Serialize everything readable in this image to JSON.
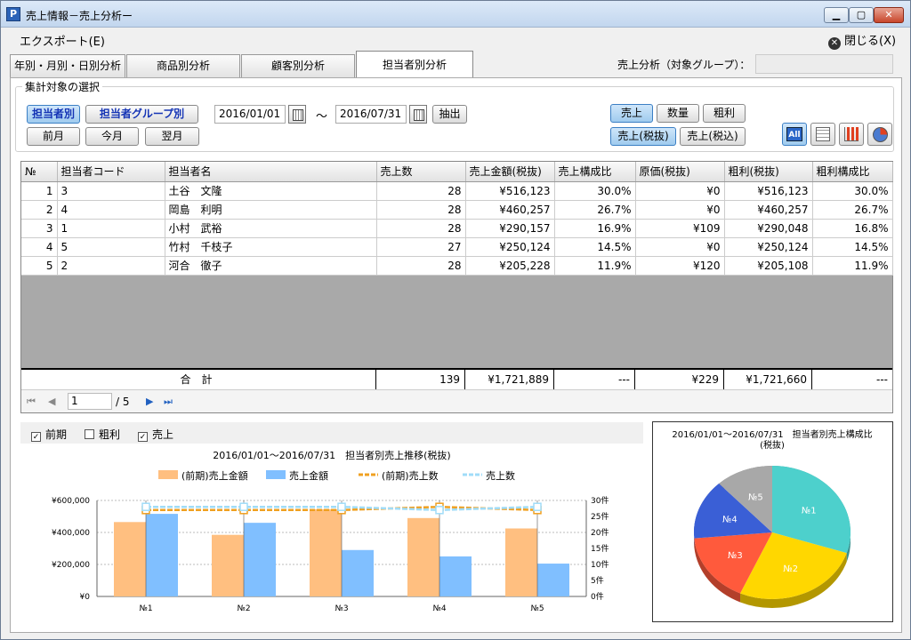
{
  "window": {
    "title": "売上情報－売上分析ー"
  },
  "menu": {
    "export": "エクスポート(E)",
    "close": "閉じる(X)"
  },
  "tabs": [
    {
      "label": "年別・月別・日別分析"
    },
    {
      "label": "商品別分析"
    },
    {
      "label": "顧客別分析"
    },
    {
      "label": "担当者別分析",
      "active": true
    }
  ],
  "group": {
    "label": "売上分析（対象グループ）：",
    "value": ""
  },
  "selection": {
    "legend": "集計対象の選択",
    "by_person": "担当者別",
    "by_group": "担当者グループ別",
    "date_from": "2016/01/01",
    "date_to": "2016/07/31",
    "tilde": "～",
    "extract": "抽出",
    "prev_month": "前月",
    "this_month": "今月",
    "next_month": "翌月",
    "metric_sales": "売上",
    "metric_qty": "数量",
    "metric_profit": "粗利",
    "tax_excl": "売上(税抜)",
    "tax_incl": "売上(税込)",
    "all_icon_text": "All"
  },
  "table": {
    "headers": [
      "№",
      "担当者コード",
      "担当者名",
      "売上数",
      "売上金額(税抜)",
      "売上構成比",
      "原価(税抜)",
      "粗利(税抜)",
      "粗利構成比"
    ],
    "rows": [
      [
        "1",
        "3",
        "土谷　文隆",
        "28",
        "¥516,123",
        "30.0%",
        "¥0",
        "¥516,123",
        "30.0%"
      ],
      [
        "2",
        "4",
        "岡島　利明",
        "28",
        "¥460,257",
        "26.7%",
        "¥0",
        "¥460,257",
        "26.7%"
      ],
      [
        "3",
        "1",
        "小村　武裕",
        "28",
        "¥290,157",
        "16.9%",
        "¥109",
        "¥290,048",
        "16.8%"
      ],
      [
        "4",
        "5",
        "竹村　千枝子",
        "27",
        "¥250,124",
        "14.5%",
        "¥0",
        "¥250,124",
        "14.5%"
      ],
      [
        "5",
        "2",
        "河合　徹子",
        "28",
        "¥205,228",
        "11.9%",
        "¥120",
        "¥205,108",
        "11.9%"
      ]
    ],
    "total": {
      "label": "合　計",
      "qty": "139",
      "sales": "¥1,721,889",
      "ratio": "---",
      "cost": "¥229",
      "profit": "¥1,721,660",
      "profit_ratio": "---"
    }
  },
  "pager": {
    "page": "1",
    "total": "/ 5"
  },
  "chart_options": [
    {
      "label": "前期",
      "checked": true
    },
    {
      "label": "粗利",
      "checked": false
    },
    {
      "label": "売上",
      "checked": true
    }
  ],
  "chart_data": [
    {
      "type": "bar",
      "title": "2016/01/01～2016/07/31　担当者別売上推移(税抜)",
      "categories": [
        "№1",
        "№2",
        "№3",
        "№4",
        "№5"
      ],
      "series": [
        {
          "name": "(前期)売上金額",
          "kind": "bar",
          "axis": "left",
          "color": "#ffbf80",
          "values": [
            465000,
            385000,
            545000,
            490000,
            425000
          ]
        },
        {
          "name": "売上金額",
          "kind": "bar",
          "axis": "left",
          "color": "#80bfff",
          "values": [
            516123,
            460257,
            290157,
            250124,
            205228
          ]
        },
        {
          "name": "(前期)売上数",
          "kind": "line",
          "axis": "right",
          "color": "#f0a020",
          "values": [
            27,
            27,
            27,
            28,
            27
          ]
        },
        {
          "name": "売上数",
          "kind": "line",
          "axis": "right",
          "color": "#a0dcf8",
          "values": [
            28,
            28,
            28,
            27,
            28
          ]
        }
      ],
      "ylim": [
        0,
        600000
      ],
      "yticks": [
        "¥0",
        "¥200,000",
        "¥400,000",
        "¥600,000"
      ],
      "y2lim": [
        0,
        30
      ],
      "y2ticks": [
        "0件",
        "5件",
        "10件",
        "15件",
        "20件",
        "25件",
        "30件"
      ],
      "legend": "top",
      "grid": true
    },
    {
      "type": "pie",
      "title": "2016/01/01～2016/07/31　担当者別売上構成比(税抜)",
      "labels": [
        "№1",
        "№2",
        "№3",
        "№4",
        "№5"
      ],
      "values": [
        30.0,
        26.7,
        16.9,
        14.5,
        11.9
      ],
      "colors": [
        "#4dd0cc",
        "#ffd700",
        "#ff5a3c",
        "#3a5fd6",
        "#a8a8a8"
      ]
    }
  ]
}
